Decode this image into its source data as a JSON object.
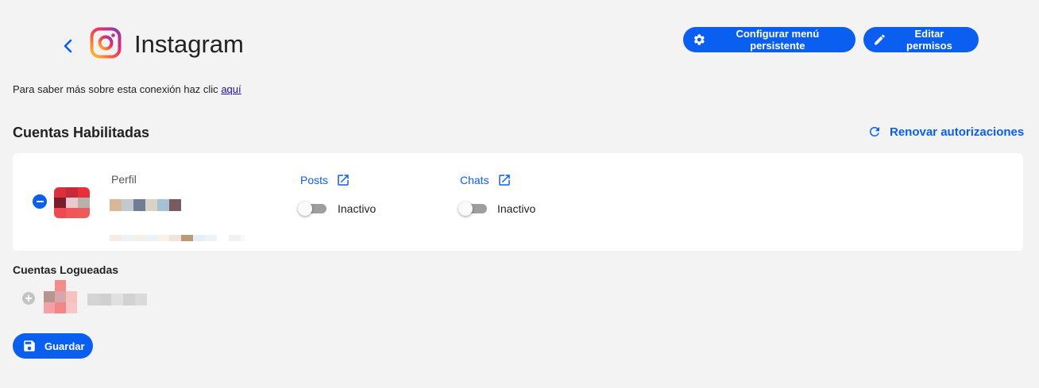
{
  "header": {
    "title": "Instagram",
    "back_icon": "chevron-left-icon",
    "logo_icon": "instagram-logo-icon"
  },
  "actions": {
    "config_menu_label": "Configurar menú persistente",
    "edit_perms_label": "Editar permisos"
  },
  "info": {
    "text": "Para saber más sobre esta conexión haz clic ",
    "link_label": "aquí"
  },
  "enabled_accounts": {
    "title": "Cuentas Habilitadas",
    "renew_label": "Renovar autorizaciones",
    "columns": {
      "profile": "Perfil",
      "posts": "Posts",
      "chats": "Chats"
    },
    "account": {
      "posts_status": "Inactivo",
      "chats_status": "Inactivo",
      "posts_active": false,
      "chats_active": false
    }
  },
  "logged_accounts": {
    "title": "Cuentas Logueadas"
  },
  "footer": {
    "save_label": "Guardar"
  },
  "colors": {
    "accent": "#0a5ef0",
    "background": "#f3f3f3",
    "card": "#ffffff",
    "toggle_off": "#9e9e9e"
  }
}
